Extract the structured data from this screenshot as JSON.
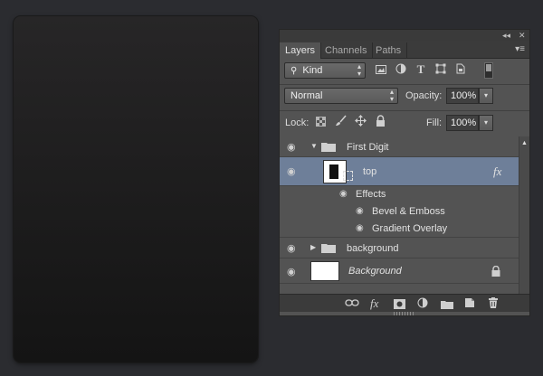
{
  "panel": {
    "tabs": [
      {
        "label": "Layers",
        "active": true
      },
      {
        "label": "Channels",
        "active": false
      },
      {
        "label": "Paths",
        "active": false
      }
    ],
    "collapse_glyph": "◂◂",
    "close_glyph": "✕",
    "menu_glyph": "▾≡"
  },
  "filter": {
    "kind_label": "Kind",
    "icons": [
      "image-filter-icon",
      "adjustment-filter-icon",
      "type-filter-icon",
      "shape-filter-icon",
      "smart-object-filter-icon",
      "toggle-filter-icon"
    ]
  },
  "blend": {
    "mode": "Normal",
    "opacity_label": "Opacity:",
    "opacity_value": "100%"
  },
  "lock": {
    "label": "Lock:",
    "fill_label": "Fill:",
    "fill_value": "100%"
  },
  "layers": [
    {
      "name": "First Digit",
      "type": "group",
      "expanded": true
    },
    {
      "name": "top",
      "type": "layer",
      "selected": true,
      "fx": "fx"
    },
    {
      "name": "Effects",
      "type": "effects-header"
    },
    {
      "name": "Bevel & Emboss",
      "type": "effect"
    },
    {
      "name": "Gradient Overlay",
      "type": "effect"
    },
    {
      "name": "background",
      "type": "group",
      "expanded": false
    },
    {
      "name": "Background",
      "type": "background",
      "locked": true
    }
  ],
  "footer": {
    "fx_label": "fx"
  },
  "colors": {
    "panel_bg": "#535353",
    "selection": "#6e7f99",
    "page_bg": "#2b2c30"
  }
}
